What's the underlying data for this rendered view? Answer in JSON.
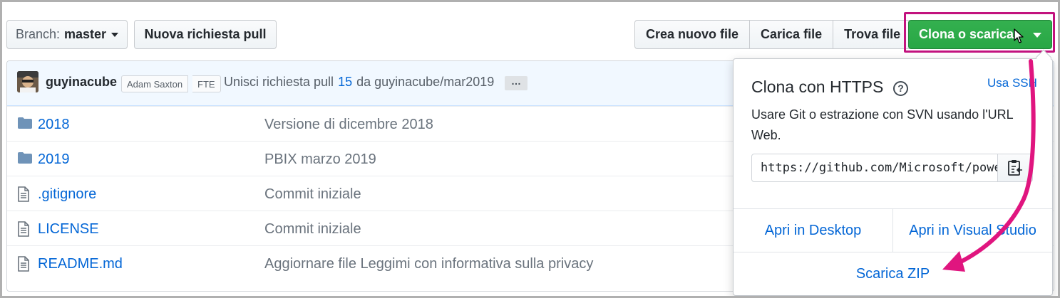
{
  "toolbar": {
    "branch_prefix": "Branch:",
    "branch_name": "master",
    "new_pull_request": "Nuova richiesta pull",
    "create_file": "Crea nuovo file",
    "upload_files": "Carica file",
    "find_file": "Trova file",
    "clone_download": "Clona o scarica"
  },
  "commit": {
    "author": "guyinacube",
    "coauthor_tag": "Adam Saxton",
    "role_tag": "FTE",
    "message_prefix": "Unisci richiesta pull",
    "pr_number": "15",
    "message_suffix": "da guyinacube/mar2019",
    "expand": "…"
  },
  "files": [
    {
      "type": "folder",
      "name": "2018",
      "message": "Versione di dicembre 2018"
    },
    {
      "type": "folder",
      "name": "2019",
      "message": "PBIX marzo 2019"
    },
    {
      "type": "file",
      "name": ".gitignore",
      "message": "Commit iniziale"
    },
    {
      "type": "file",
      "name": "LICENSE",
      "message": "Commit iniziale"
    },
    {
      "type": "file",
      "name": "README.md",
      "message": "Aggiornare file Leggimi con informativa sulla privacy"
    }
  ],
  "clone_popup": {
    "title": "Clona con HTTPS",
    "help_icon": "?",
    "use_ssh": "Usa SSH",
    "description": "Usare Git o estrazione con SVN usando l'URL Web.",
    "url": "https://github.com/Microsoft/powerbi-desktop-samples.git",
    "open_desktop": "Apri in Desktop",
    "open_visual_studio": "Apri in Visual Studio",
    "download_zip": "Scarica ZIP"
  },
  "colors": {
    "accent_link": "#0366d6",
    "clone_button": "#28a745",
    "annotation": "#e0157f"
  },
  "icons": {
    "folder": "folder-icon",
    "file": "file-icon",
    "copy": "clipboard-icon",
    "help": "question-circle-icon",
    "cursor": "mouse-pointer-icon"
  }
}
